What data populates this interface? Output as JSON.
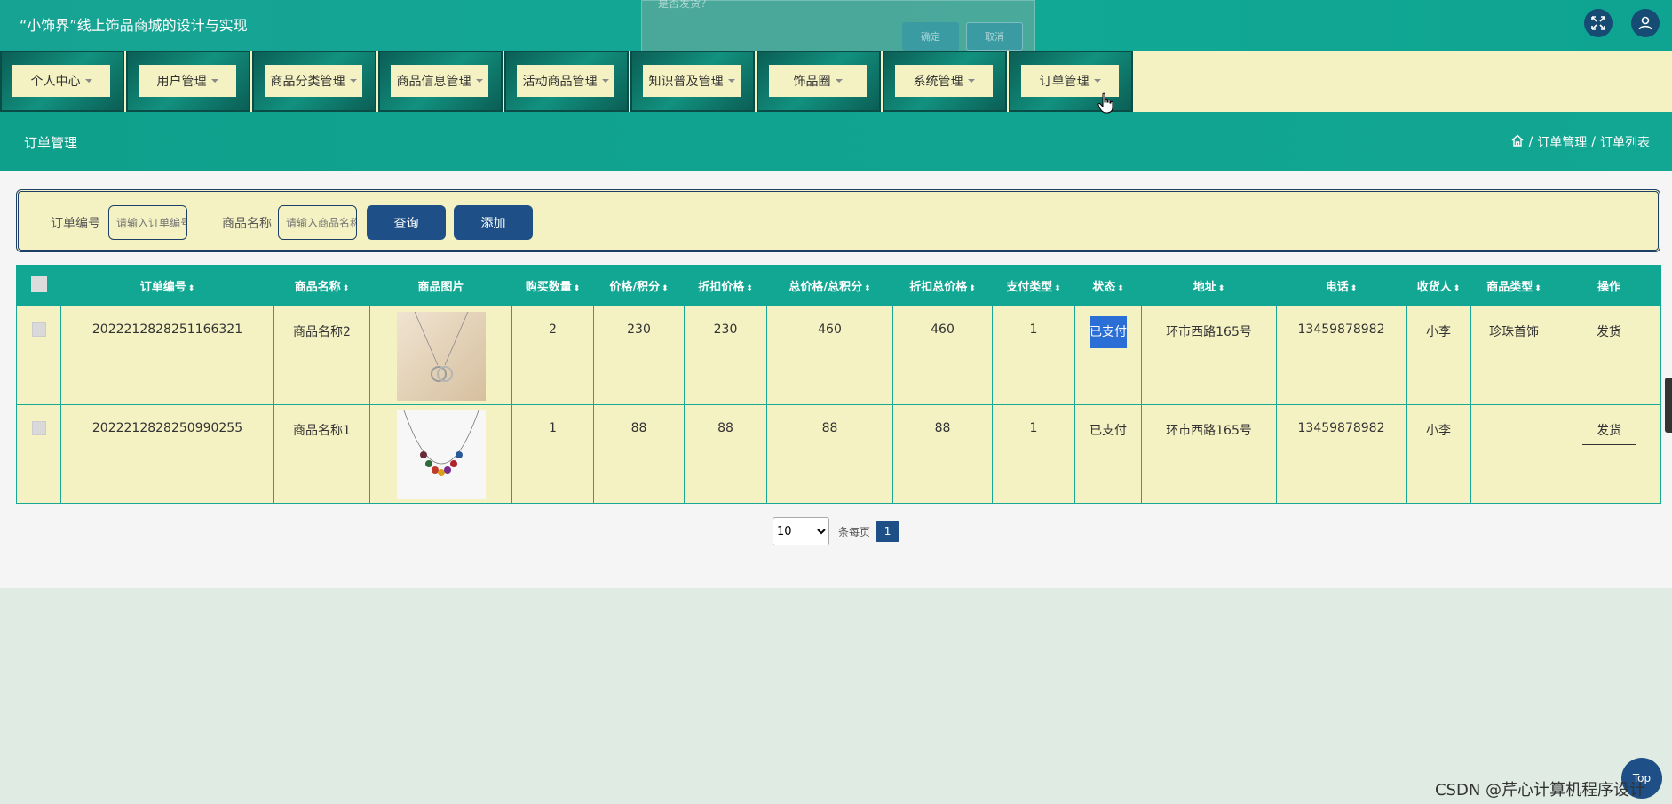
{
  "header": {
    "title": "“小饰界”线上饰品商城的设计与实现"
  },
  "dialog": {
    "message": "是否发货？",
    "ok_label": "确定",
    "cancel_label": "取消"
  },
  "nav": {
    "items": [
      {
        "label": "个人中心"
      },
      {
        "label": "用户管理"
      },
      {
        "label": "商品分类管理"
      },
      {
        "label": "商品信息管理"
      },
      {
        "label": "活动商品管理"
      },
      {
        "label": "知识普及管理"
      },
      {
        "label": "饰品圈"
      },
      {
        "label": "系统管理"
      },
      {
        "label": "订单管理"
      }
    ]
  },
  "page": {
    "title": "订单管理",
    "breadcrumb": [
      "订单管理",
      "订单列表"
    ],
    "sep": "/"
  },
  "search": {
    "order_no_label": "订单编号",
    "order_no_placeholder": "请输入订单编号",
    "product_name_label": "商品名称",
    "product_name_placeholder": "请输入商品名称",
    "query_label": "查询",
    "add_label": "添加"
  },
  "table": {
    "columns": [
      "订单编号",
      "商品名称",
      "商品图片",
      "购买数量",
      "价格/积分",
      "折扣价格",
      "总价格/总积分",
      "折扣总价格",
      "支付类型",
      "状态",
      "地址",
      "电话",
      "收货人",
      "商品类型",
      "操作"
    ],
    "rows": [
      {
        "order_no": "2022212828251166321",
        "name": "商品名称2",
        "image": "necklace-rings",
        "qty": "2",
        "price": "230",
        "discount_price": "230",
        "total": "460",
        "discount_total": "460",
        "pay_type": "1",
        "status": "已支付",
        "address": "环市西路165号",
        "phone": "13459878982",
        "receiver": "小李",
        "category": "珍珠首饰",
        "action": "发货"
      },
      {
        "order_no": "2022212828250990255",
        "name": "商品名称1",
        "image": "necklace-beads",
        "qty": "1",
        "price": "88",
        "discount_price": "88",
        "total": "88",
        "discount_total": "88",
        "pay_type": "1",
        "status": "已支付",
        "address": "环市西路165号",
        "phone": "13459878982",
        "receiver": "小李",
        "category": "",
        "action": "发货"
      }
    ]
  },
  "pager": {
    "page_size": "10",
    "per_page_label": "条每页",
    "current_page": "1"
  },
  "footer": {
    "top_label": "Top",
    "watermark": "CSDN @芹心计算机程序设计"
  },
  "colors": {
    "teal": "#12a793",
    "cream": "#f4f2c2",
    "navy": "#1e4f86"
  }
}
